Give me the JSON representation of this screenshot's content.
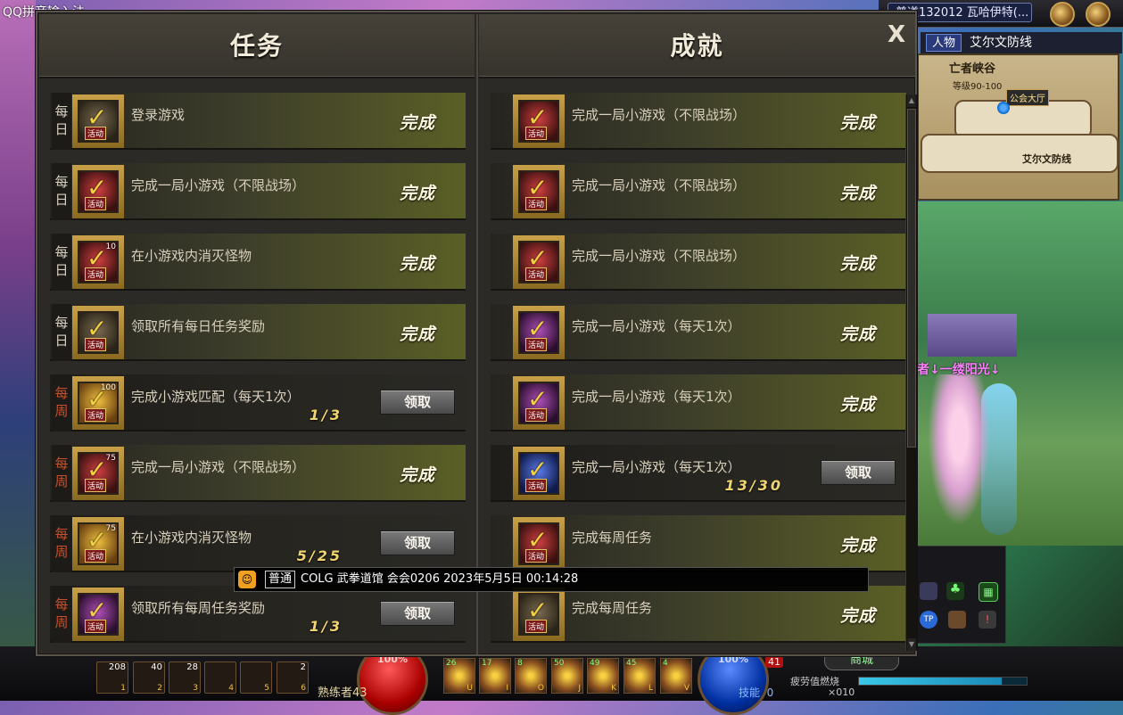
{
  "ime": {
    "label": "QQ拼音输入法"
  },
  "hud": {
    "server": "普道132012 瓦哈伊特(...",
    "map_tab": "人物",
    "area_name": "艾尔文防线",
    "minimap_title": "亡者峡谷",
    "minimap_level": "等级90-100",
    "minimap_guild": "公会大厅",
    "minimap_front": "艾尔文防线",
    "player_name": "者↓一缕阳光↓",
    "hp_pct": "100%",
    "mp_pct": "100%",
    "proficiency": "熟练者43",
    "skill_label": "技能",
    "skill_points": "0",
    "fatigue_label": "疲劳值燃烧",
    "shop_label": "商城",
    "badge": "41",
    "coin_count": "×010",
    "fatigue_level": 0.85,
    "quick_slots": [
      {
        "num": "208",
        "key": "1"
      },
      {
        "num": "40",
        "key": "2"
      },
      {
        "num": "28",
        "key": "3"
      },
      {
        "num": "",
        "key": "4"
      },
      {
        "num": "",
        "key": "5"
      },
      {
        "num": "2",
        "key": "6"
      }
    ],
    "skill_slots": [
      {
        "num": "26",
        "key": "U"
      },
      {
        "num": "17",
        "key": "I"
      },
      {
        "num": "8",
        "key": "O"
      },
      {
        "num": "50",
        "key": "J"
      },
      {
        "num": "49",
        "key": "K"
      },
      {
        "num": "45",
        "key": "L"
      },
      {
        "num": "4",
        "key": "V"
      }
    ]
  },
  "dialog": {
    "left_header": "任务",
    "right_header": "成就",
    "close": "X"
  },
  "quests": [
    {
      "period": "每日",
      "weekly": false,
      "title": "登录游戏",
      "status": "完成",
      "progress": "",
      "button": "",
      "icon": "normal",
      "count": ""
    },
    {
      "period": "每日",
      "weekly": false,
      "title": "完成一局小游戏（不限战场）",
      "status": "完成",
      "progress": "",
      "button": "",
      "icon": "red",
      "count": ""
    },
    {
      "period": "每日",
      "weekly": false,
      "title": "在小游戏内消灭怪物",
      "status": "完成",
      "progress": "",
      "button": "",
      "icon": "red",
      "count": "10"
    },
    {
      "period": "每日",
      "weekly": false,
      "title": "领取所有每日任务奖励",
      "status": "完成",
      "progress": "",
      "button": "",
      "icon": "normal",
      "count": ""
    },
    {
      "period": "每周",
      "weekly": true,
      "title": "完成小游戏匹配（每天1次）",
      "status": "",
      "progress": "1/3",
      "button": "领取",
      "icon": "gold",
      "count": "100"
    },
    {
      "period": "每周",
      "weekly": true,
      "title": "完成一局小游戏（不限战场）",
      "status": "完成",
      "progress": "",
      "button": "",
      "icon": "red",
      "count": "75"
    },
    {
      "period": "每周",
      "weekly": true,
      "title": "在小游戏内消灭怪物",
      "status": "",
      "progress": "5/25",
      "button": "领取",
      "icon": "gold",
      "count": "75"
    },
    {
      "period": "每周",
      "weekly": true,
      "title": "领取所有每周任务奖励",
      "status": "",
      "progress": "1/3",
      "button": "领取",
      "icon": "purple",
      "count": ""
    }
  ],
  "achievements": [
    {
      "title": "完成一局小游戏（不限战场）",
      "status": "完成",
      "progress": "",
      "button": "",
      "icon": "red"
    },
    {
      "title": "完成一局小游戏（不限战场）",
      "status": "完成",
      "progress": "",
      "button": "",
      "icon": "red"
    },
    {
      "title": "完成一局小游戏（不限战场）",
      "status": "完成",
      "progress": "",
      "button": "",
      "icon": "red"
    },
    {
      "title": "完成一局小游戏（每天1次）",
      "status": "完成",
      "progress": "",
      "button": "",
      "icon": "purple"
    },
    {
      "title": "完成一局小游戏（每天1次）",
      "status": "完成",
      "progress": "",
      "button": "",
      "icon": "purple"
    },
    {
      "title": "完成一局小游戏（每天1次）",
      "status": "",
      "progress": "13/30",
      "button": "领取",
      "icon": "blue"
    },
    {
      "title": "完成每周任务",
      "status": "完成",
      "progress": "",
      "button": "",
      "icon": "red"
    },
    {
      "title": "完成每周任务",
      "status": "完成",
      "progress": "",
      "button": "",
      "icon": "normal"
    }
  ],
  "chat": {
    "channel": "普通",
    "text": "COLG 武拳道馆 会会0206 2023年5月5日 00:14:28"
  }
}
